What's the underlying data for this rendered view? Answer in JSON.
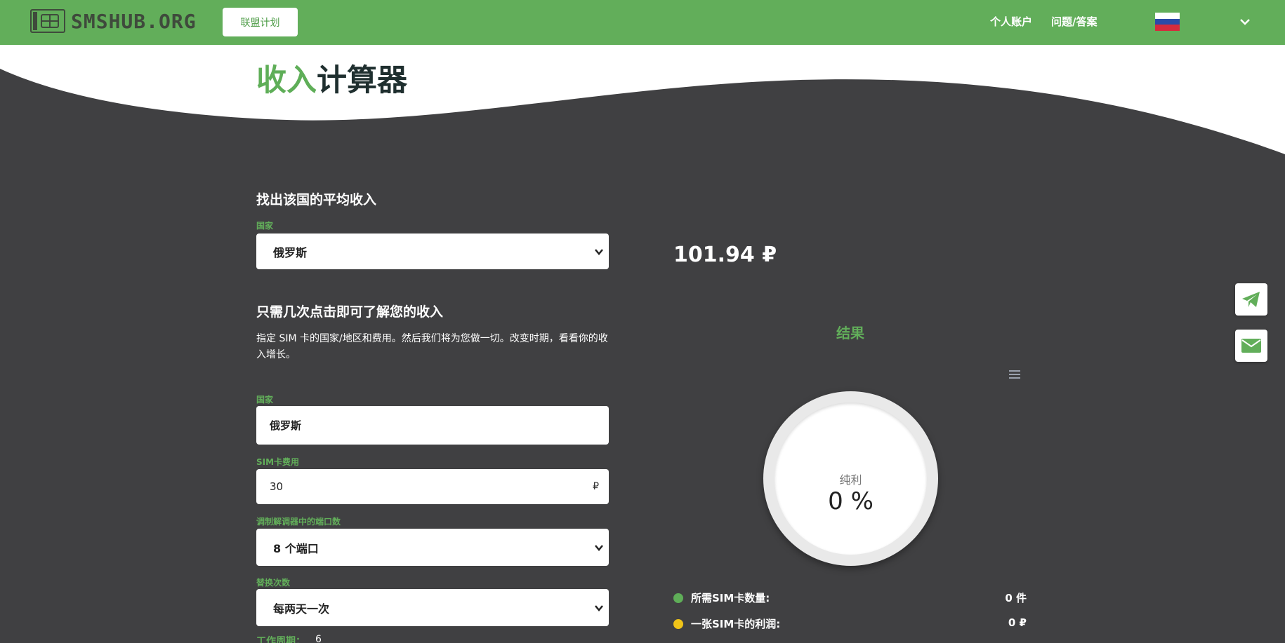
{
  "header": {
    "logo_text": "SMSHUB.ORG",
    "affiliate_label": "联盟计划",
    "nav": [
      {
        "label": "个人账户"
      },
      {
        "label": "问题/答案"
      }
    ]
  },
  "page": {
    "title_accent": "收入",
    "title_rest": "计算器"
  },
  "avg_section": {
    "title": "找出该国的平均收入",
    "country_label": "国家",
    "country_value": "俄罗斯"
  },
  "calc_section": {
    "title": "只需几次点击即可了解您的收入",
    "description": "指定 SIM 卡的国家/地区和费用。然后我们将为您做一切。改变时期，看看你的收入增长。",
    "country_label": "国家",
    "country_value": "俄罗斯",
    "sim_cost_label": "SIM卡费用",
    "sim_cost_value": "30",
    "currency_symbol": "₽",
    "ports_label": "调制解调器中的端口数",
    "ports_value": "8 个端口",
    "replace_label": "替换次数",
    "replace_value": "每两天一次",
    "work_period_label": "工作周期：",
    "work_period_value": "6"
  },
  "results": {
    "avg_income": "101.94 ₽",
    "title": "结果",
    "gauge_label": "纯利",
    "gauge_value": "0 %",
    "stats": [
      {
        "label": "所需SIM卡数量:",
        "value": "0 件",
        "color": "#5fae58"
      },
      {
        "label": "一张SIM卡的利润:",
        "value": "0 ₽",
        "color": "#f0c419"
      }
    ]
  },
  "colors": {
    "brand_green": "#62ae5a",
    "background_dark": "#404042",
    "title_dark": "#1f2f2f"
  },
  "icons": {
    "logo": "sim-card-icon",
    "language_flag": "russia-flag-icon",
    "language_dropdown": "chevron-down-icon",
    "chart_menu": "menu-icon",
    "telegram": "telegram-icon",
    "email": "envelope-icon"
  }
}
